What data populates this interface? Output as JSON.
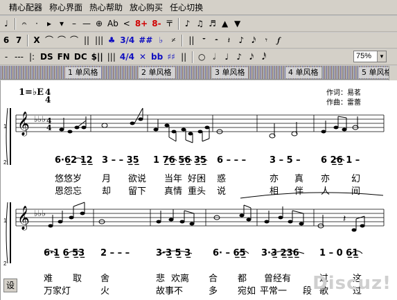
{
  "menubar": {
    "items": [
      "精心配器",
      "称心界面",
      "热心帮助",
      "放心购买",
      "任心切换"
    ]
  },
  "toolbar1": {
    "buttons": [
      "♩",
      "𝄐",
      "·",
      "▸",
      "▾",
      "–",
      "—",
      "⊕",
      "Ab",
      "<",
      "8+",
      "8-",
      "〒",
      "♪",
      "♫",
      "♬",
      "▲",
      "▼"
    ]
  },
  "toolbar2": {
    "buttons": [
      "6",
      "7",
      "X",
      "⌒",
      "⌒",
      "⌒",
      "||",
      "|||",
      "♣",
      "3/4",
      "##",
      "♭",
      "𝄎",
      "||",
      "𝄻",
      "𝄼",
      "𝄽",
      "♪",
      "𝅘𝅥𝅯",
      "𝄾",
      "𝆑",
      "♩"
    ]
  },
  "toolbar3": {
    "buttons": [
      "-",
      "---",
      "|:",
      "DS",
      "FN",
      "DC",
      "$||",
      "|||",
      "4/4",
      "✕",
      "bb",
      "♯♯",
      "||",
      "○",
      "𝅗𝅥",
      "♩",
      "♪",
      "𝅘𝅥𝅯",
      "𝅘𝅥𝅰",
      "𝆔"
    ],
    "zoom_value": "75%"
  },
  "tabs": [
    {
      "num": "1",
      "label": "单风格"
    },
    {
      "num": "2",
      "label": "单风格"
    },
    {
      "num": "3",
      "label": "单风格"
    },
    {
      "num": "4",
      "label": "单风格"
    },
    {
      "num": "5",
      "label": "单风格"
    }
  ],
  "score": {
    "key": "1=♭E",
    "time_top": "4",
    "time_bottom": "4",
    "lyricist": "作词：易茗",
    "composer": "作曲：雷蕾",
    "system1": {
      "jianpu": "6·6̣2 12 | 3 – – 35 | 1 76 56 35 | 6 – – – | 3 – 5 – | 6 26 1 –",
      "bars": [
        "6·6̲2 1̲2̲",
        "3 – – 3̲5̲",
        "1 7̲6̲ 5̲6̲ 3̲5̲",
        "6 – – –",
        "3 – 5 –",
        "6 2̲6̲ 1 –"
      ],
      "lyrics1": [
        "悠悠岁",
        "月",
        "欲说",
        "当年",
        "好困",
        "惑",
        "亦",
        "真",
        "亦",
        "幻"
      ],
      "lyrics2": [
        "恩怨忘",
        "却",
        "留下",
        "真情",
        "重头",
        "说",
        "相",
        "伴",
        "人",
        "间"
      ]
    },
    "system2": {
      "bars": [
        "6·1̲ 6̲ 5̲3̲",
        "2 – – –",
        "3·3̲ 5̲ 3̲",
        "6· – 6̲5̲",
        "3·3̲ 2̲3̲6̲",
        "1 – 0 6̲1̲"
      ],
      "lyrics1": [
        "难",
        "取",
        "舍",
        "悲",
        "欢离",
        "合",
        "都",
        "曾经有",
        "过",
        "这"
      ],
      "lyrics2": [
        "万家灯",
        "火",
        "故事不",
        "多",
        "宛如",
        "平常一",
        "段",
        "歌",
        "过"
      ]
    },
    "corner_label": "设"
  },
  "watermark": "Discuz!"
}
